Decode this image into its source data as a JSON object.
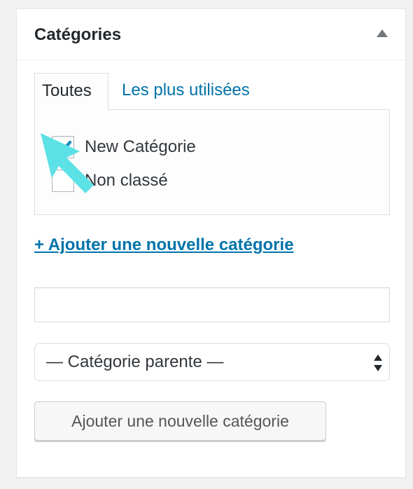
{
  "panel": {
    "title": "Catégories",
    "toggle_icon": "arrow-up-icon"
  },
  "tabs": [
    {
      "label": "Toutes",
      "active": true
    },
    {
      "label": "Les plus utilisées",
      "active": false
    }
  ],
  "categories": [
    {
      "label": "New Catégorie",
      "checked": true
    },
    {
      "label": "Non classé",
      "checked": false
    }
  ],
  "add_link": "+ Ajouter une nouvelle catégorie",
  "new_category_input": {
    "value": "",
    "placeholder": ""
  },
  "parent_select": {
    "selected": "— Catégorie parente —"
  },
  "add_button": "Ajouter une nouvelle catégorie",
  "colors": {
    "link": "#0073aa",
    "check": "#1e8cbe",
    "cursor": "#5ce1e6",
    "border": "#dddddd"
  },
  "overlay": {
    "cursor_icon": "cursor-arrow-icon"
  }
}
